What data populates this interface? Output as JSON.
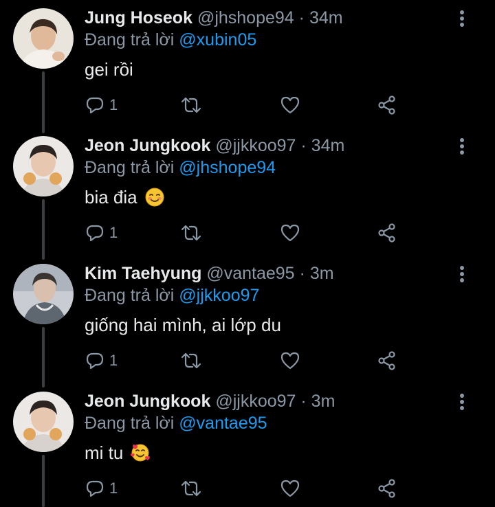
{
  "colors": {
    "background": "#000000",
    "name": "#e7e9ea",
    "secondary": "#8b98a5",
    "mention": "#1d9bf0",
    "thread_line": "#3a3f44"
  },
  "tweets": [
    {
      "name": "Jung Hoseok",
      "handle": "@jhshope94",
      "dot": "·",
      "time": "34m",
      "reply_prefix": "Đang trả lời",
      "reply_to": "@xubin05",
      "text": "gei rồi",
      "emoji": "",
      "reply_count": "1",
      "icons": [
        "reply-icon",
        "retweet-icon",
        "like-icon",
        "share-icon",
        "more-icon"
      ]
    },
    {
      "name": "Jeon Jungkook",
      "handle": "@jjkkoo97",
      "dot": "·",
      "time": "34m",
      "reply_prefix": "Đang trả lời",
      "reply_to": "@jhshope94",
      "text": "bia đia",
      "emoji": "smiling-face-emoji",
      "reply_count": "1",
      "icons": [
        "reply-icon",
        "retweet-icon",
        "like-icon",
        "share-icon",
        "more-icon"
      ]
    },
    {
      "name": "Kim Taehyung",
      "handle": "@vantae95",
      "dot": "·",
      "time": "3m",
      "reply_prefix": "Đang trả lời",
      "reply_to": "@jjkkoo97",
      "text": "giống hai mình, ai lớp du",
      "emoji": "",
      "reply_count": "1",
      "icons": [
        "reply-icon",
        "retweet-icon",
        "like-icon",
        "share-icon",
        "more-icon"
      ]
    },
    {
      "name": "Jeon Jungkook",
      "handle": "@jjkkoo97",
      "dot": "·",
      "time": "3m",
      "reply_prefix": "Đang trả lời",
      "reply_to": "@vantae95",
      "text": "mi tu",
      "emoji": "smiling-face-with-hearts-emoji",
      "reply_count": "1",
      "icons": [
        "reply-icon",
        "retweet-icon",
        "like-icon",
        "share-icon",
        "more-icon"
      ]
    }
  ]
}
